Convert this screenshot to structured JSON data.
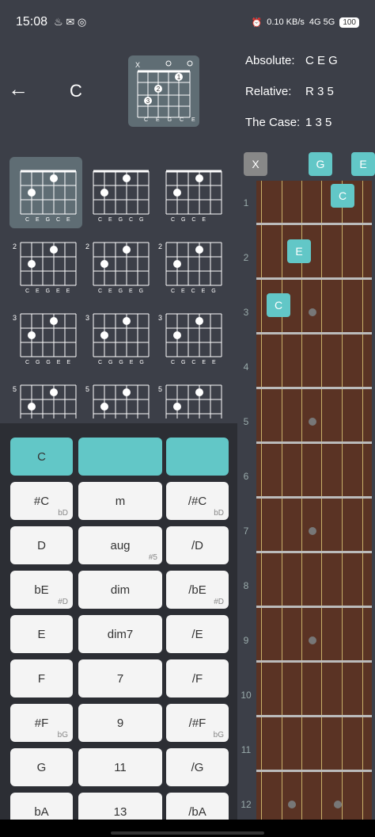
{
  "status": {
    "time": "15:08",
    "data_rate": "0.10 KB/s",
    "network": "4G 5G",
    "battery": "100"
  },
  "header": {
    "chord": "C",
    "diagram_strings": [
      "C",
      "E",
      "G",
      "C",
      "E"
    ],
    "absolute_label": "Absolute:",
    "absolute_value": "C E G",
    "relative_label": "Relative:",
    "relative_value": "R 3 5",
    "case_label": "The Case:",
    "case_value": "1 3 5"
  },
  "voicings": [
    {
      "strings": "C E G C E",
      "fret": ""
    },
    {
      "strings": "C E G C G",
      "fret": ""
    },
    {
      "strings": "C  G C E",
      "fret": ""
    },
    {
      "strings": "C E G E E",
      "fret": "2"
    },
    {
      "strings": "C E G E G",
      "fret": "2"
    },
    {
      "strings": "C E C E G",
      "fret": "2"
    },
    {
      "strings": "C G G E E",
      "fret": "3"
    },
    {
      "strings": "C G G E G",
      "fret": "3"
    },
    {
      "strings": "C G C E E",
      "fret": "3"
    },
    {
      "strings": "",
      "fret": "5"
    },
    {
      "strings": "",
      "fret": "5"
    },
    {
      "strings": "",
      "fret": "5"
    }
  ],
  "buttons": [
    [
      {
        "l": "C",
        "s": ""
      },
      {
        "l": "",
        "s": ""
      },
      {
        "l": "",
        "s": ""
      }
    ],
    [
      {
        "l": "#C",
        "s": "bD"
      },
      {
        "l": "m",
        "s": ""
      },
      {
        "l": "/#C",
        "s": "bD"
      }
    ],
    [
      {
        "l": "D",
        "s": ""
      },
      {
        "l": "aug",
        "s": "#5"
      },
      {
        "l": "/D",
        "s": ""
      }
    ],
    [
      {
        "l": "bE",
        "s": "#D"
      },
      {
        "l": "dim",
        "s": ""
      },
      {
        "l": "/bE",
        "s": "#D"
      }
    ],
    [
      {
        "l": "E",
        "s": ""
      },
      {
        "l": "dim7",
        "s": ""
      },
      {
        "l": "/E",
        "s": ""
      }
    ],
    [
      {
        "l": "F",
        "s": ""
      },
      {
        "l": "7",
        "s": ""
      },
      {
        "l": "/F",
        "s": ""
      }
    ],
    [
      {
        "l": "#F",
        "s": "bG"
      },
      {
        "l": "9",
        "s": ""
      },
      {
        "l": "/#F",
        "s": "bG"
      }
    ],
    [
      {
        "l": "G",
        "s": ""
      },
      {
        "l": "11",
        "s": ""
      },
      {
        "l": "/G",
        "s": ""
      }
    ],
    [
      {
        "l": "bA",
        "s": ""
      },
      {
        "l": "13",
        "s": ""
      },
      {
        "l": "/bA",
        "s": ""
      }
    ]
  ],
  "fretboard": {
    "top_notes": [
      "X",
      "G",
      "E"
    ],
    "fret_numbers": [
      "1",
      "2",
      "3",
      "4",
      "5",
      "6",
      "7",
      "8",
      "9",
      "10",
      "11",
      "12"
    ],
    "notes": [
      "C",
      "E",
      "C"
    ]
  }
}
